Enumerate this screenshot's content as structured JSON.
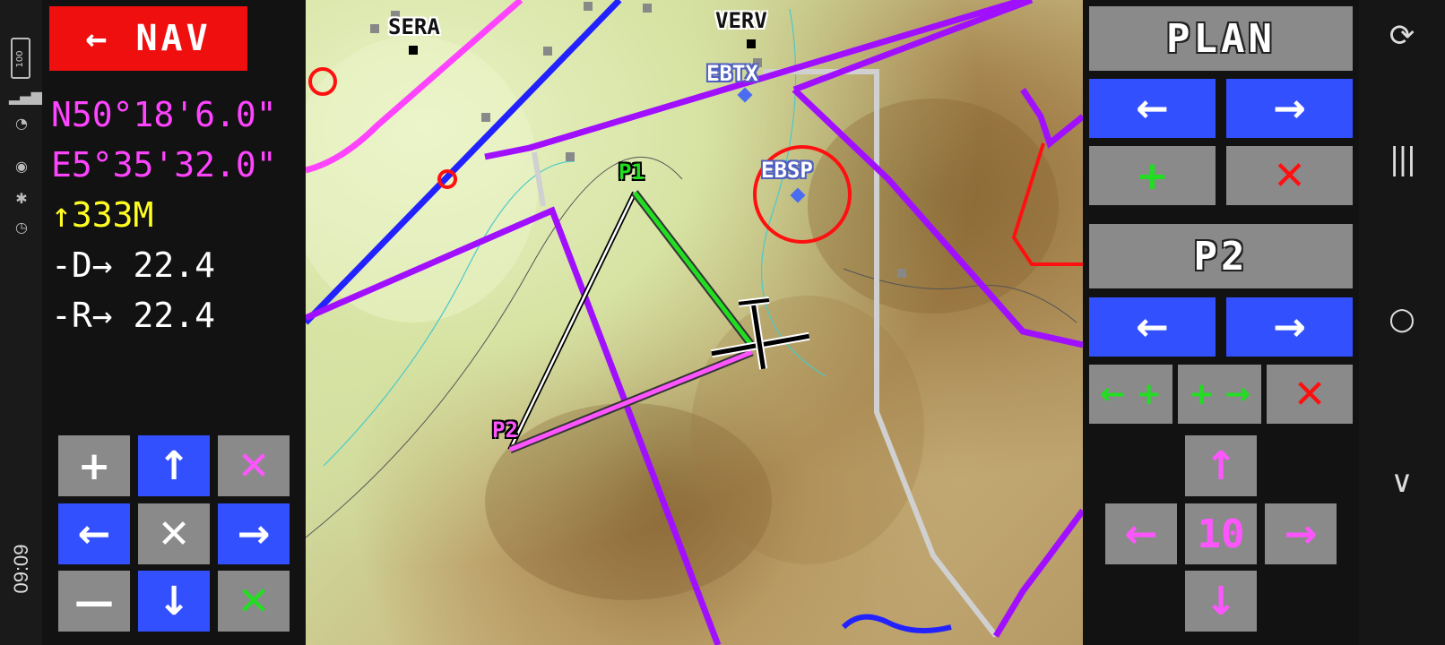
{
  "status_bar": {
    "time": "09:09",
    "battery": "100",
    "icons": [
      "battery-icon",
      "signal-icon",
      "wifi-icon",
      "eye-icon",
      "bluetooth-icon",
      "alarm-icon"
    ]
  },
  "left_panel": {
    "nav_button": "← NAV",
    "latitude": "N50°18'6.0\"",
    "longitude": "E5°35'32.0\"",
    "altitude": "↑333M",
    "distance": "-D→ 22.4",
    "range": "-R→ 22.4",
    "keypad": [
      {
        "name": "zoom-in-button",
        "glyph": "+"
      },
      {
        "name": "up-button",
        "glyph": "↑"
      },
      {
        "name": "clear-marker-button",
        "glyph": "✕"
      },
      {
        "name": "left-button",
        "glyph": "←"
      },
      {
        "name": "center-button",
        "glyph": "✕"
      },
      {
        "name": "right-button",
        "glyph": "→"
      },
      {
        "name": "zoom-out-button",
        "glyph": "—"
      },
      {
        "name": "down-button",
        "glyph": "↓"
      },
      {
        "name": "confirm-button",
        "glyph": "✕"
      }
    ]
  },
  "map": {
    "labels": {
      "sera": "SERA",
      "verv": "VERV",
      "ebtx": "EBTX",
      "ebsp": "EBSP",
      "p1": "P1",
      "p2": "P2"
    }
  },
  "right_panel": {
    "plan_title": "PLAN",
    "plan_prev": "←",
    "plan_next": "→",
    "plan_add": "+",
    "plan_delete": "✕",
    "point_title": "P2",
    "point_prev": "←",
    "point_next": "→",
    "insert_before": "← +",
    "insert_after": "+ →",
    "point_delete": "✕",
    "move_up": "↑",
    "move_left": "←",
    "step_value": "10",
    "move_right": "→",
    "move_down": "↓"
  },
  "colors": {
    "nav_red": "#f00f0f",
    "button_blue": "#3350ff",
    "button_gray": "#8a8a8a",
    "readout_magenta": "#ff44ff",
    "readout_yellow": "#ffff22",
    "airspace_purple": "#a010ff",
    "route_green": "#22dd22",
    "route_magenta": "#ff55ff"
  },
  "nav_bar": {
    "icons": [
      "rotate-icon",
      "recents-icon",
      "home-icon",
      "back-icon"
    ]
  }
}
